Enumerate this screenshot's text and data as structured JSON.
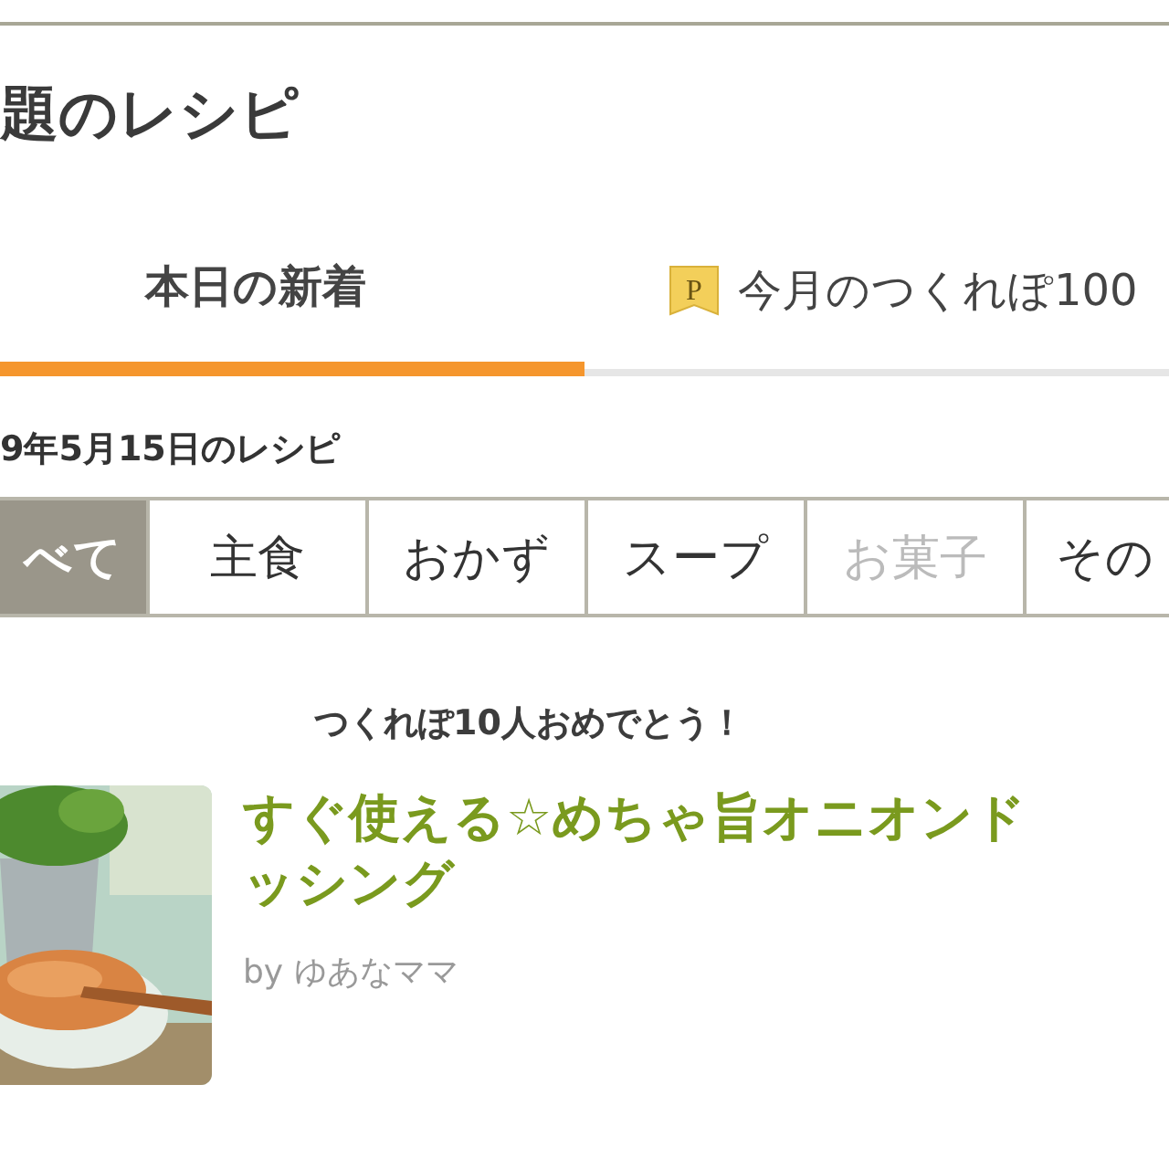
{
  "page_title": "題のレシピ",
  "tabs": [
    {
      "label": "本日の新着",
      "selected": true,
      "kind": "plain"
    },
    {
      "label": "今月のつくれぽ100",
      "selected": false,
      "kind": "badge",
      "badge": "P"
    }
  ],
  "date_heading": "9年5月15日のレシピ",
  "categories": [
    {
      "label": "べて",
      "selected": true,
      "disabled": false
    },
    {
      "label": "主食",
      "selected": false,
      "disabled": false
    },
    {
      "label": "おかず",
      "selected": false,
      "disabled": false
    },
    {
      "label": "スープ",
      "selected": false,
      "disabled": false
    },
    {
      "label": "お菓子",
      "selected": false,
      "disabled": true
    },
    {
      "label": "その",
      "selected": false,
      "disabled": false
    }
  ],
  "banner": "つくれぽ10人おめでとう！",
  "recipe": {
    "title_lines": [
      "すぐ使える☆めちゃ旨オニオンド",
      "ッシング"
    ],
    "author": "by ゆあなママ"
  }
}
